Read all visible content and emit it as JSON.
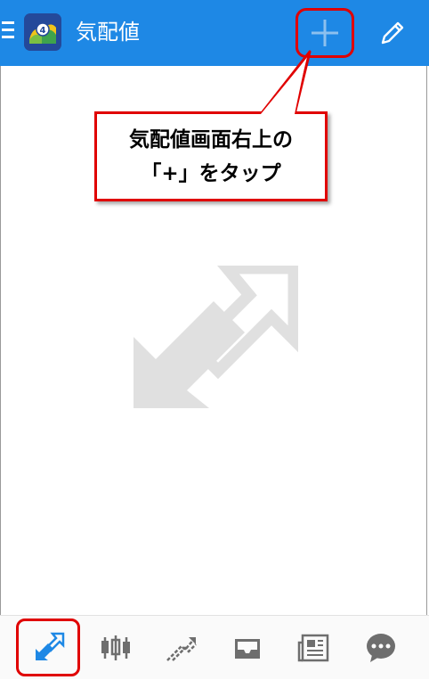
{
  "app": {
    "title": "気配値",
    "logo_icon": "metatrader4-logo-icon",
    "accent_color": "#1e88e5"
  },
  "toolbar": {
    "menu_icon": "hamburger-menu-icon",
    "add_icon": "plus-icon",
    "edit_icon": "pencil-icon"
  },
  "callout": {
    "line1": "気配値画面右上の",
    "line2": "「+」をタップ",
    "border_color": "#e00000"
  },
  "empty_state": {
    "icon": "double-arrow-icon"
  },
  "bottom_nav": {
    "items": [
      {
        "icon": "quotes-arrows-icon",
        "active": true
      },
      {
        "icon": "candlestick-chart-icon",
        "active": false
      },
      {
        "icon": "trade-icon",
        "active": false
      },
      {
        "icon": "inbox-tray-icon",
        "active": false
      },
      {
        "icon": "news-icon",
        "active": false
      },
      {
        "icon": "chat-bubble-icon",
        "active": false
      }
    ],
    "active_color": "#1e88e5",
    "inactive_color": "#6e6e6e"
  }
}
